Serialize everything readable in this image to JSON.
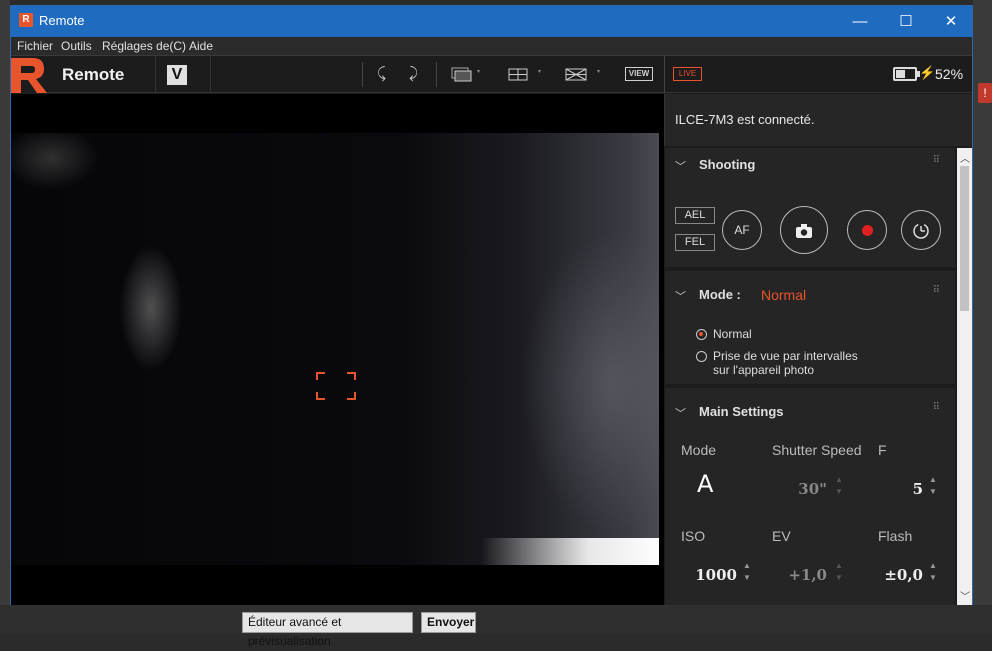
{
  "window": {
    "title": "Remote",
    "icon_letter": "R"
  },
  "menu": {
    "items": [
      "Fichier",
      "Outils",
      "Réglages de(C)",
      "Aide"
    ]
  },
  "toolbar": {
    "app_name": "Remote",
    "v_label": "V",
    "view_label": "VIEW",
    "live_label": "LIVE",
    "battery_pct": "52%",
    "battery_level": 0.52,
    "accent": "#e8542b"
  },
  "status": {
    "text": "ILCE-7M3 est connecté."
  },
  "shooting": {
    "title": "Shooting",
    "ael": "AEL",
    "fel": "FEL",
    "af": "AF"
  },
  "mode": {
    "title": "Mode :",
    "value": "Normal",
    "options": [
      "Normal",
      "Prise de vue par intervalles",
      "sur l'appareil photo"
    ]
  },
  "main_settings": {
    "title": "Main Settings",
    "labels": {
      "mode": "Mode",
      "shutter": "Shutter Speed",
      "f": "F",
      "iso": "ISO",
      "ev": "EV",
      "flash": "Flash"
    },
    "values": {
      "mode": "A",
      "shutter": "30\"",
      "f": "5",
      "iso": "1000",
      "ev": "+1,0",
      "flash": "±0,0"
    }
  },
  "footer": {
    "edit_button": "Éditeur avancé et prévisualisation",
    "send_button": "Envoyer"
  }
}
